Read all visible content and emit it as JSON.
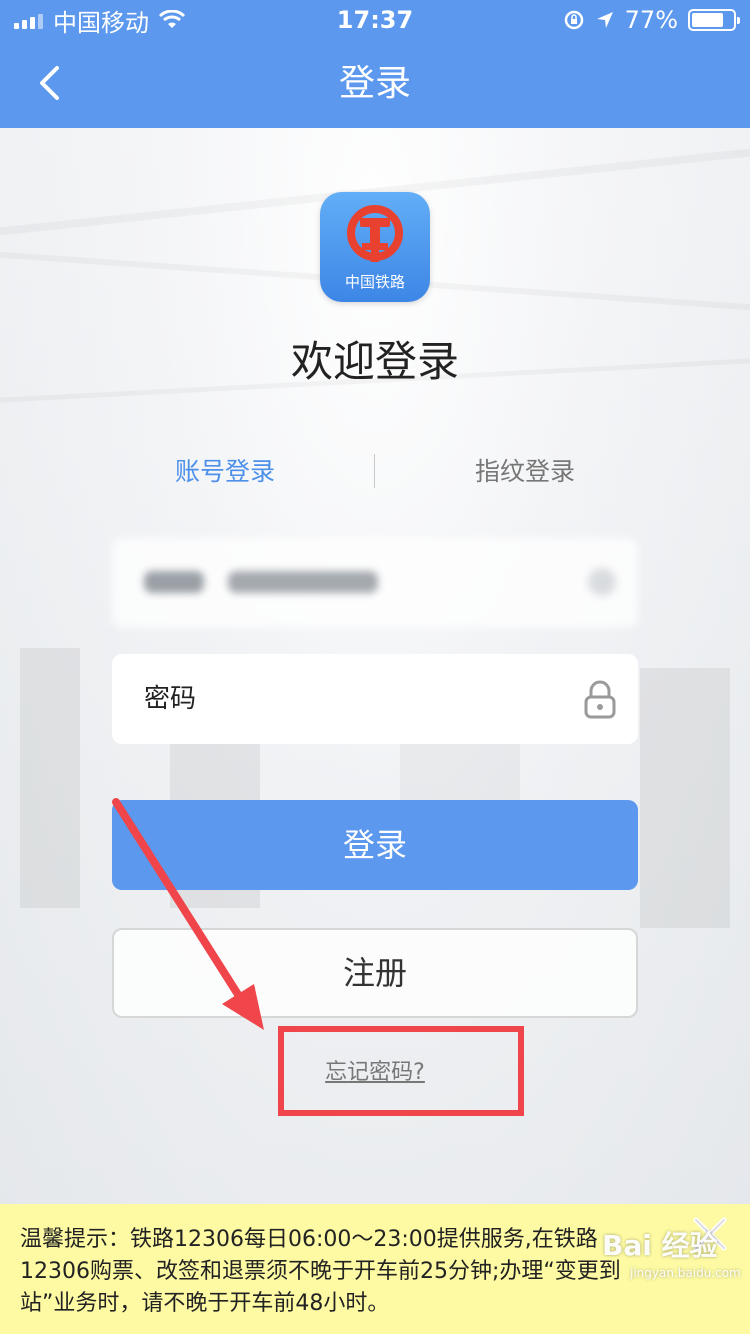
{
  "status_bar": {
    "carrier": "中国移动",
    "time": "17:37",
    "battery_percent": "77%",
    "battery_level": 0.77
  },
  "nav": {
    "title": "登录",
    "back_icon": "chevron-left-icon"
  },
  "logo": {
    "text": "中国铁路",
    "icon": "china-railway-logo-icon"
  },
  "welcome": "欢迎登录",
  "tabs": [
    {
      "label": "账号登录",
      "active": true
    },
    {
      "label": "指纹登录",
      "active": false
    }
  ],
  "form": {
    "account_value": "",
    "password_placeholder": "密码",
    "password_icon": "lock-icon"
  },
  "buttons": {
    "login": "登录",
    "register": "注册",
    "forgot_password": "忘记密码?"
  },
  "notice": {
    "text": "温馨提示：铁路12306每日06:00～23:00提供服务,在铁路12306购票、改签和退票须不晚于开车前25分钟;办理“变更到站”业务时，请不晚于开车前48小时。",
    "close_icon": "close-icon"
  },
  "watermark": {
    "text": "Bai 经验",
    "sub": "jingyan.baidu.com"
  },
  "colors": {
    "primary": "#5b98ee",
    "tab_active": "#4d90ea",
    "annotation": "#f0454a",
    "notice_bg": "#fdfaa3"
  }
}
